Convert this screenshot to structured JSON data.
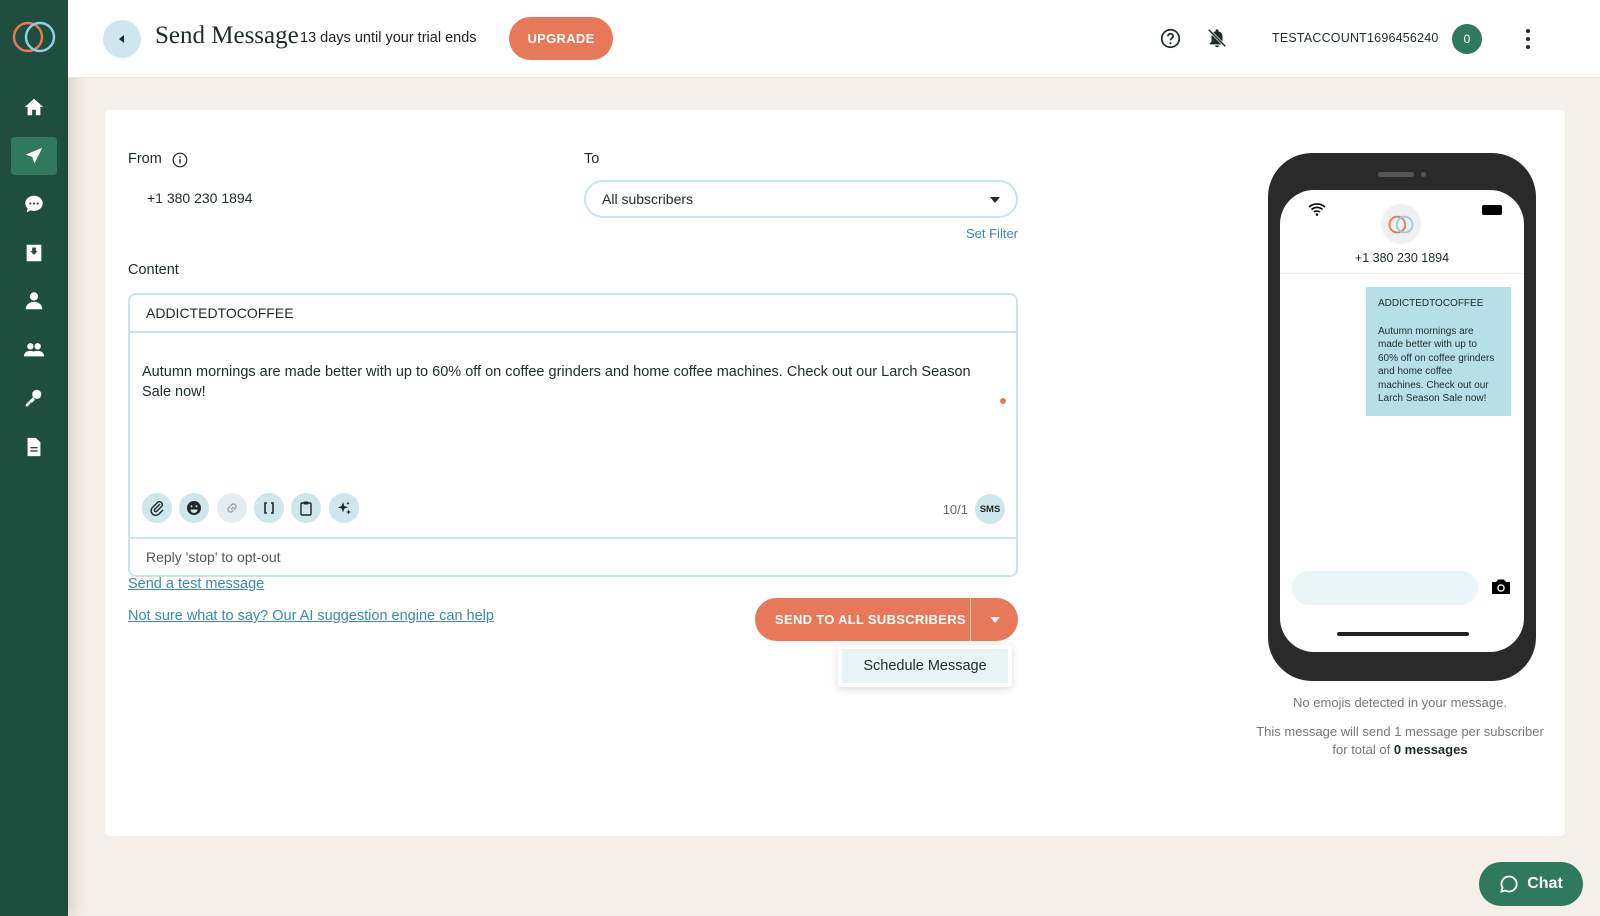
{
  "header": {
    "title": "Send Message",
    "trial_text": "13 days until your trial ends",
    "upgrade_label": "UPGRADE",
    "account_name": "TESTACCOUNT1696456240",
    "account_badge": "0"
  },
  "sidebar": {
    "items": [
      {
        "icon": "home-icon"
      },
      {
        "icon": "send-icon",
        "active": true
      },
      {
        "icon": "chat-bubble-icon"
      },
      {
        "icon": "inbox-icon"
      },
      {
        "icon": "user-icon"
      },
      {
        "icon": "users-icon"
      },
      {
        "icon": "key-icon"
      },
      {
        "icon": "document-icon"
      }
    ]
  },
  "form": {
    "from_label": "From",
    "from_value": "+1 380 230 1894",
    "to_label": "To",
    "to_value": "All subscribers",
    "set_filter": "Set Filter",
    "content_label": "Content",
    "subject": "ADDICTEDTOCOFFEE",
    "body": "Autumn mornings are made better with up to 60% off on coffee grinders and home coffee machines. Check out our Larch Season Sale now!",
    "char_count": "10/1",
    "sms_badge": "SMS",
    "optout": "Reply 'stop' to opt-out",
    "test_link": "Send a test message",
    "ai_link": "Not sure what to say? Our AI suggestion engine can help",
    "send_label": "SEND TO ALL SUBSCRIBERS",
    "schedule_label": "Schedule Message"
  },
  "preview": {
    "sender": "+1 380 230 1894",
    "subject": "ADDICTEDTOCOFFEE",
    "body": "Autumn mornings are made better with up to 60% off on coffee grinders and home coffee machines. Check out our Larch Season Sale now!",
    "emoji_note": "No emojis detected in your message.",
    "count_note_prefix": "This message will send 1 message per subscriber for total of",
    "count_note_bold": "0 messages"
  },
  "chat": {
    "label": "Chat"
  },
  "colors": {
    "sidebar": "#1f4d3e",
    "accent": "#e8785a",
    "link": "#3a89a8",
    "bubble": "#b7dfe8"
  }
}
